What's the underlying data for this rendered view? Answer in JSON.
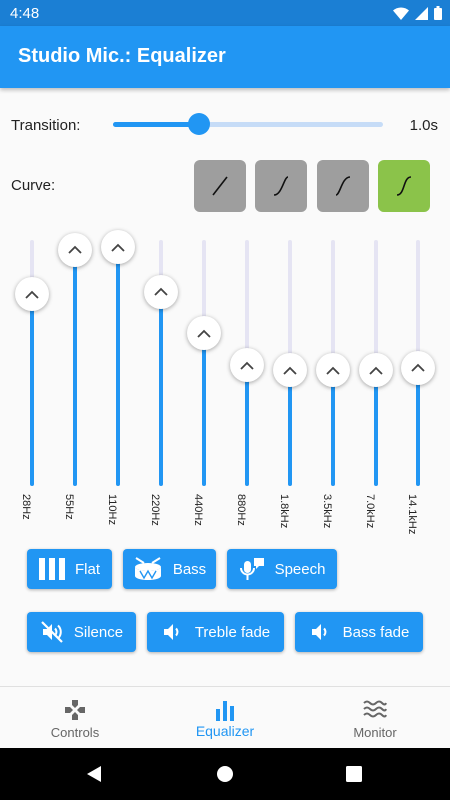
{
  "status": {
    "time": "4:48"
  },
  "app": {
    "title": "Studio Mic.: Equalizer"
  },
  "transition": {
    "label": "Transition:",
    "value_label": "1.0s",
    "position": 0.32
  },
  "curve": {
    "label": "Curve:",
    "options": [
      "linear",
      "ease-in",
      "ease-out",
      "ease-in-out"
    ],
    "selected_index": 3
  },
  "equalizer": {
    "bands": [
      {
        "label": "28Hz",
        "level": 0.78
      },
      {
        "label": "55Hz",
        "level": 0.96
      },
      {
        "label": "110Hz",
        "level": 0.97
      },
      {
        "label": "220Hz",
        "level": 0.79
      },
      {
        "label": "440Hz",
        "level": 0.62
      },
      {
        "label": "880Hz",
        "level": 0.49
      },
      {
        "label": "1.8kHz",
        "level": 0.47
      },
      {
        "label": "3.5kHz",
        "level": 0.47
      },
      {
        "label": "7.0kHz",
        "level": 0.47
      },
      {
        "label": "14.1kHz",
        "level": 0.48
      }
    ]
  },
  "presets": {
    "flat": "Flat",
    "bass": "Bass",
    "speech": "Speech",
    "silence": "Silence",
    "treble_fade": "Treble fade",
    "bass_fade": "Bass fade"
  },
  "nav": {
    "controls": "Controls",
    "equalizer": "Equalizer",
    "monitor": "Monitor"
  },
  "colors": {
    "primary": "#2196f3",
    "status_bar": "#1b7fd4",
    "selected_curve": "#8bc34a",
    "curve_button": "#9e9e9e",
    "track": "#e5e4f3"
  },
  "icons": {
    "wifi": "wifi-icon",
    "signal": "cellular-signal-icon",
    "battery": "battery-icon",
    "controls": "gamepad-icon",
    "equalizer": "equalizer-bars-icon",
    "monitor": "waves-icon"
  }
}
